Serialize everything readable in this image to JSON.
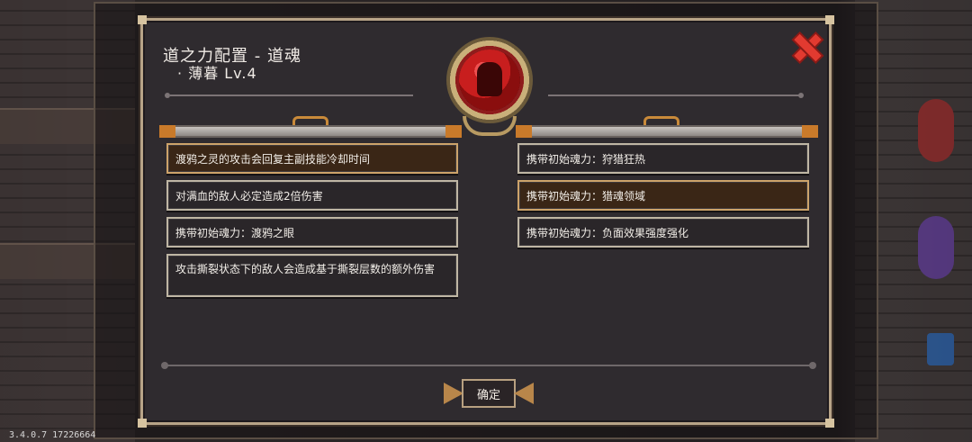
{
  "dialog": {
    "title": "道之力配置 - 道魂",
    "subtitle": "· 薄暮 Lv.4",
    "close_icon": "close-x-icon",
    "confirm_label": "确定"
  },
  "medallion": {
    "icon": "soul-portrait-icon",
    "color": "#c81e1e"
  },
  "left_list": [
    {
      "text": "渡鸦之灵的攻击会回复主副技能冷却时间",
      "selected": true
    },
    {
      "text": "对满血的敌人必定造成2倍伤害",
      "selected": false
    },
    {
      "text": "携带初始魂力：渡鸦之眼",
      "selected": false
    },
    {
      "text": "攻击撕裂状态下的敌人会造成基于撕裂层数的额外伤害",
      "selected": false
    }
  ],
  "right_list": [
    {
      "text": "携带初始魂力：狩猎狂热",
      "selected": false
    },
    {
      "text": "携带初始魂力：猎魂领域",
      "selected": true
    },
    {
      "text": "携带初始魂力：负面效果强度强化",
      "selected": false
    }
  ],
  "version": "3.4.0.7 17226664",
  "colors": {
    "frame": "#b8a488",
    "selected_bg": "#3a2616",
    "close_red": "#e23a30"
  }
}
